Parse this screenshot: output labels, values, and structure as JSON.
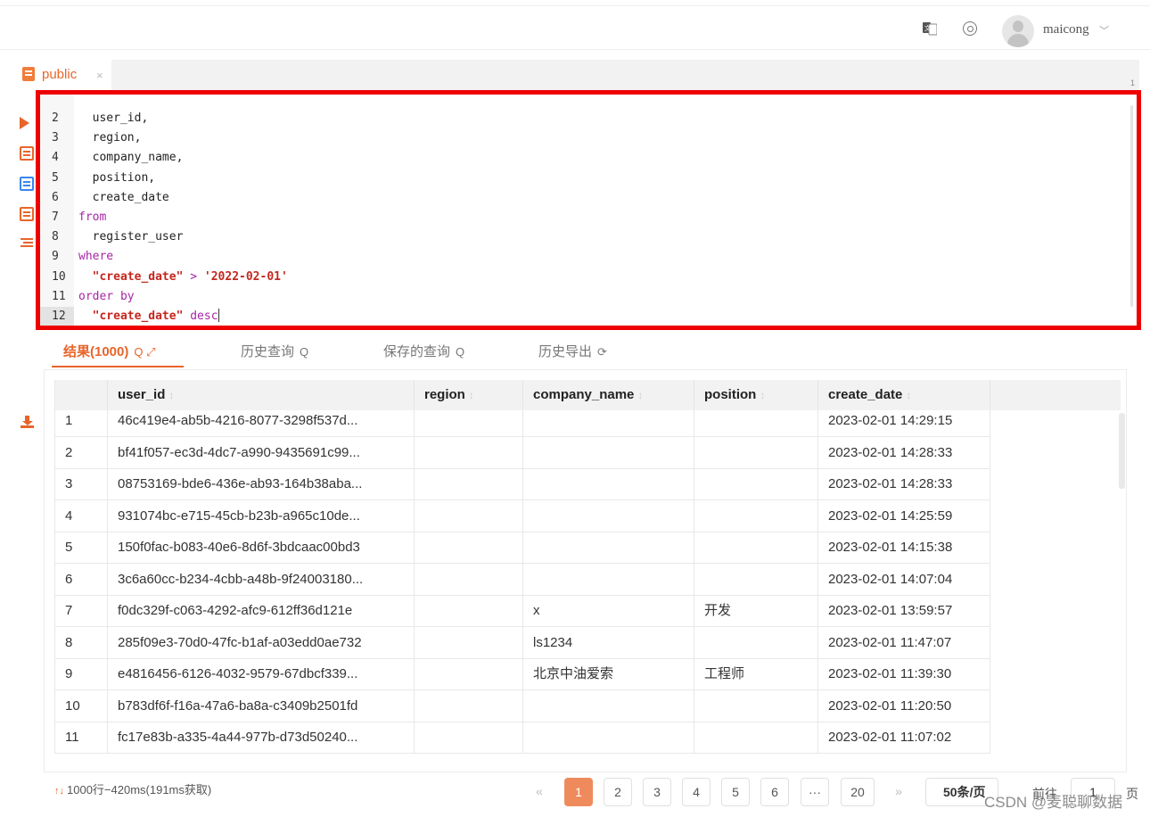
{
  "header": {
    "username": "maicong",
    "icons": [
      "translate-icon",
      "help-icon",
      "avatar",
      "chevron-down-icon"
    ]
  },
  "tab": {
    "label": "public",
    "close": "×",
    "line_indicator": "1"
  },
  "toolbar": {
    "icons": [
      "run-icon",
      "format-icon",
      "copy-icon",
      "save-icon",
      "outline-icon",
      "export-icon"
    ]
  },
  "editor": {
    "lines": [
      {
        "num": "2",
        "parts": [
          {
            "t": "  user_id,",
            "c": "plain"
          }
        ]
      },
      {
        "num": "3",
        "parts": [
          {
            "t": "  region,",
            "c": "plain"
          }
        ]
      },
      {
        "num": "4",
        "parts": [
          {
            "t": "  company_name,",
            "c": "plain"
          }
        ]
      },
      {
        "num": "5",
        "parts": [
          {
            "t": "  position,",
            "c": "plain"
          }
        ]
      },
      {
        "num": "6",
        "parts": [
          {
            "t": "  create_date",
            "c": "plain"
          }
        ]
      },
      {
        "num": "7",
        "parts": [
          {
            "t": "from",
            "c": "kw"
          }
        ]
      },
      {
        "num": "8",
        "parts": [
          {
            "t": "  register_user",
            "c": "plain"
          }
        ]
      },
      {
        "num": "9",
        "parts": [
          {
            "t": "where",
            "c": "kw"
          }
        ]
      },
      {
        "num": "10",
        "parts": [
          {
            "t": "  \"create_date\"",
            "c": "str"
          },
          {
            "t": " > ",
            "c": "op"
          },
          {
            "t": "'2022-02-01'",
            "c": "str"
          }
        ]
      },
      {
        "num": "11",
        "parts": [
          {
            "t": "order by",
            "c": "kw"
          }
        ]
      },
      {
        "num": "12",
        "parts": [
          {
            "t": "  \"create_date\"",
            "c": "str"
          },
          {
            "t": " desc",
            "c": "kw"
          }
        ],
        "active": true
      }
    ]
  },
  "result_tabs": {
    "results": "结果(1000)",
    "results_icons": "Q ⤢",
    "history": "历史查询",
    "saved": "保存的查询",
    "export_history": "历史导出",
    "search_glyph": "Q",
    "refresh_glyph": "⟳"
  },
  "grid": {
    "columns": [
      "",
      "user_id",
      "region",
      "company_name",
      "position",
      "create_date"
    ],
    "sort_glyph": "↕",
    "rows": [
      [
        "1",
        "46c419e4-ab5b-4216-8077-3298f537d...",
        "",
        "",
        "",
        "2023-02-01 14:29:15"
      ],
      [
        "2",
        "bf41f057-ec3d-4dc7-a990-9435691c99...",
        "",
        "",
        "",
        "2023-02-01 14:28:33"
      ],
      [
        "3",
        "08753169-bde6-436e-ab93-164b38aba...",
        "",
        "",
        "",
        "2023-02-01 14:28:33"
      ],
      [
        "4",
        "931074bc-e715-45cb-b23b-a965c10de...",
        "",
        "",
        "",
        "2023-02-01 14:25:59"
      ],
      [
        "5",
        "150f0fac-b083-40e6-8d6f-3bdcaac00bd3",
        "",
        "",
        "",
        "2023-02-01 14:15:38"
      ],
      [
        "6",
        "3c6a60cc-b234-4cbb-a48b-9f24003180...",
        "",
        "",
        "",
        "2023-02-01 14:07:04"
      ],
      [
        "7",
        "f0dc329f-c063-4292-afc9-612ff36d121e",
        "",
        "x",
        "开发",
        "2023-02-01 13:59:57"
      ],
      [
        "8",
        "285f09e3-70d0-47fc-b1af-a03edd0ae732",
        "",
        "ls1234",
        "",
        "2023-02-01 11:47:07"
      ],
      [
        "9",
        "e4816456-6126-4032-9579-67dbcf339...",
        "",
        "北京中油爱索",
        "工程师",
        "2023-02-01 11:39:30"
      ],
      [
        "10",
        "b783df6f-f16a-47a6-ba8a-c3409b2501fd",
        "",
        "",
        "",
        "2023-02-01 11:20:50"
      ],
      [
        "11",
        "fc17e83b-a335-4a44-977b-d73d50240...",
        "",
        "",
        "",
        "2023-02-01 11:07:02"
      ]
    ]
  },
  "footer": {
    "status_arrows": "↑↓",
    "status": "1000行−420ms(191ms获取)",
    "pages": [
      "«",
      "1",
      "2",
      "3",
      "4",
      "5",
      "6",
      "···",
      "20",
      "»"
    ],
    "active_page": "1",
    "page_size": "50条/页",
    "goto_label": "前往",
    "goto_value": "1",
    "page_unit": "页"
  },
  "watermark": "CSDN @麦聪聊数据"
}
